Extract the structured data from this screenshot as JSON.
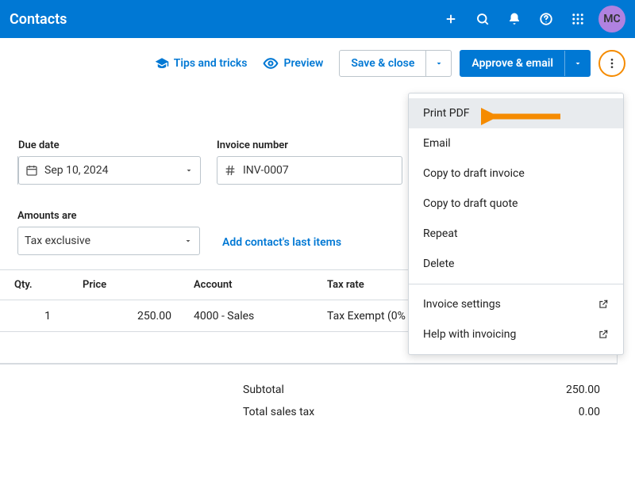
{
  "topbar": {
    "title": "Contacts",
    "avatar": "MC"
  },
  "actions": {
    "tips": "Tips and tricks",
    "preview": "Preview",
    "save_close": "Save & close",
    "approve_email": "Approve & email"
  },
  "fields": {
    "due_label": "Due date",
    "due_value": "Sep 10, 2024",
    "inv_label": "Invoice number",
    "inv_value": "INV-0007",
    "amounts_label": "Amounts are",
    "amounts_value": "Tax exclusive",
    "add_last": "Add contact's last items"
  },
  "table": {
    "headers": {
      "qty": "Qty.",
      "price": "Price",
      "account": "Account",
      "tax": "Tax rate"
    },
    "rows": [
      {
        "qty": "1",
        "price": "250.00",
        "account": "4000 - Sales",
        "tax": "Tax Exempt (0%"
      }
    ]
  },
  "totals": {
    "subtotal_label": "Subtotal",
    "subtotal_value": "250.00",
    "tax_label": "Total sales tax",
    "tax_value": "0.00"
  },
  "menu": {
    "print_pdf": "Print PDF",
    "email": "Email",
    "copy_invoice": "Copy to draft invoice",
    "copy_quote": "Copy to draft quote",
    "repeat": "Repeat",
    "delete": "Delete",
    "settings": "Invoice settings",
    "help": "Help with invoicing"
  }
}
